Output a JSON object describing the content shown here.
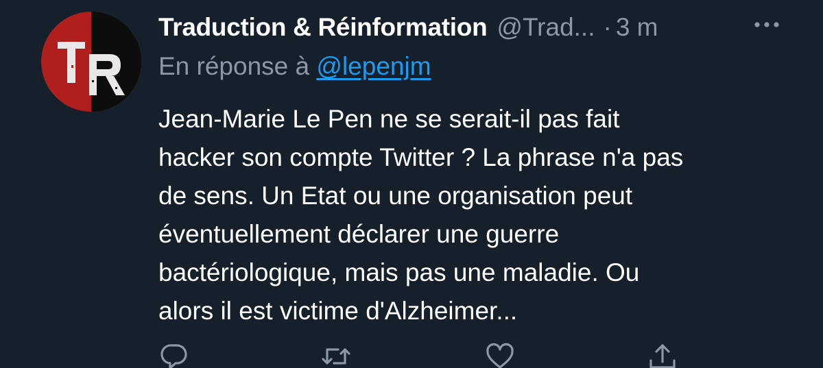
{
  "tweet": {
    "author": {
      "display_name": "Traduction & Réinformation",
      "handle": "@Trad...",
      "avatar_letters": "TR"
    },
    "separator": "·",
    "time": "3 m",
    "reply_prefix": "En réponse à",
    "reply_mention": "@lepenjm",
    "text_lines": [
      "Jean-Marie Le Pen ne se serait-il pas fait",
      "hacker son compte Twitter ? La phrase n'a pas",
      "de sens. Un Etat ou une organisation peut",
      "éventuellement déclarer une guerre",
      "bactériologique, mais pas une maladie. Ou",
      "alors il est victime d'Alzheimer..."
    ],
    "actions": {
      "reply_icon": "reply-icon",
      "retweet_icon": "retweet-icon",
      "like_icon": "heart-icon",
      "share_icon": "share-icon"
    },
    "more_icon": "more-icon"
  },
  "colors": {
    "background": "#15202b",
    "text_primary": "#ffffff",
    "text_secondary": "#8b98a5",
    "link": "#1d9bf0",
    "avatar_red": "#b01e1e"
  }
}
